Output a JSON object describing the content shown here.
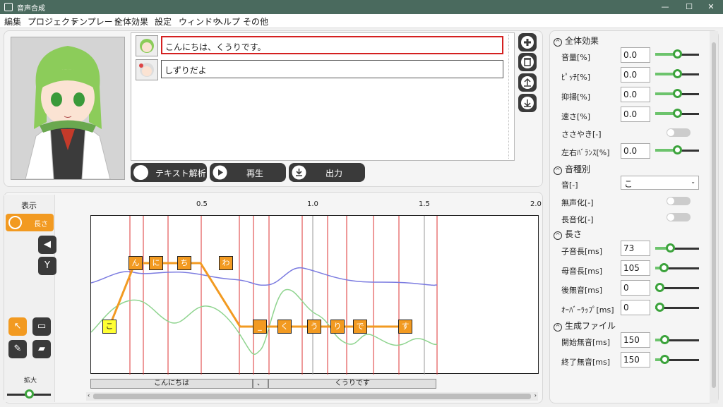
{
  "window": {
    "title": "音声合成",
    "min": "—",
    "max": "☐",
    "close": "✕"
  },
  "menu": [
    "編集",
    "プロジェクト",
    "テンプレート",
    "全体効果",
    "設定",
    "ウィンドウ",
    "ヘルプ",
    "その他"
  ],
  "texts": [
    {
      "value": "こんにちは、くうりです。",
      "active": true
    },
    {
      "value": "しずりだよ",
      "active": false
    }
  ],
  "actions": {
    "analyze": "テキスト解析",
    "play": "再生",
    "output": "出力"
  },
  "left_panel": {
    "display_label": "表示",
    "length_button": "長さ",
    "zoom_label": "拡大",
    "zoom_level": 0.5
  },
  "timeline": {
    "ticks": [
      "0.5",
      "1.0",
      "1.5",
      "2.0"
    ],
    "morae": [
      "こ",
      "ん",
      "に",
      "ち",
      "わ",
      "_",
      "く",
      "う",
      "り",
      "で",
      "す"
    ],
    "segments": [
      "こんにちは",
      "、",
      "くうりです"
    ]
  },
  "global_effects": {
    "title": "全体効果",
    "params": [
      {
        "label": "音量[%]",
        "value": "0.0",
        "level": 0.5
      },
      {
        "label": "ﾋﾟｯﾁ[%]",
        "value": "0.0",
        "level": 0.5
      },
      {
        "label": "抑揚[%]",
        "value": "0.0",
        "level": 0.5
      },
      {
        "label": "速さ[%]",
        "value": "0.0",
        "level": 0.5
      }
    ],
    "whisper_label": "ささやき[-]",
    "balance_label": "左右ﾊﾞﾗﾝｽ[%]",
    "balance_value": "0.0",
    "balance_level": 0.5
  },
  "phoneme": {
    "title": "音種別",
    "sound_label": "音[-]",
    "sound_value": "こ",
    "devoice_label": "無声化[-]",
    "long_label": "長音化[-]"
  },
  "length": {
    "title": "長さ",
    "params": [
      {
        "label": "子音長[ms]",
        "value": "73",
        "level": 0.3
      },
      {
        "label": "母音長[ms]",
        "value": "105",
        "level": 0.12
      },
      {
        "label": "後無音[ms]",
        "value": "0",
        "level": 0.0
      },
      {
        "label": "ｵｰﾊﾞｰﾗｯﾌﾟ[ms]",
        "value": "0",
        "level": 0.0
      }
    ]
  },
  "output_file": {
    "title": "生成ファイル",
    "params": [
      {
        "label": "開始無音[ms]",
        "value": "150",
        "level": 0.15
      },
      {
        "label": "終了無音[ms]",
        "value": "150",
        "level": 0.15
      }
    ]
  },
  "colors": {
    "accent": "#f29a21",
    "titlebar": "#4a6a5e",
    "pitch": "#7b7be0",
    "volume": "#8fd48f",
    "slider": "#3ca33c"
  }
}
